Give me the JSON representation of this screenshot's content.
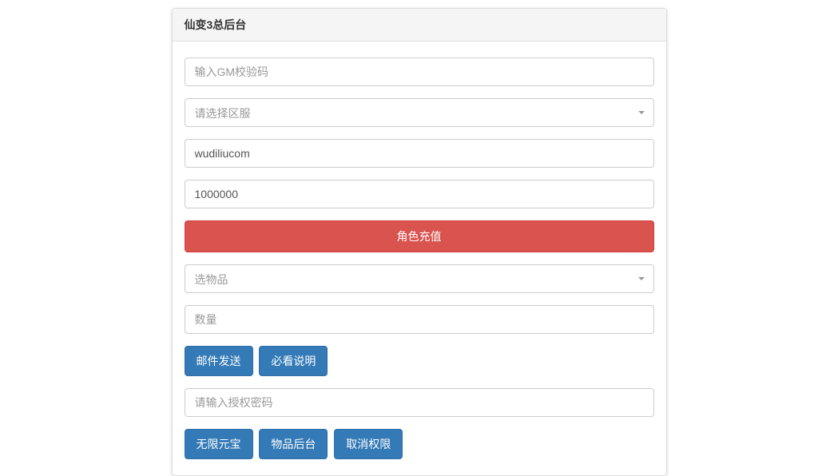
{
  "panel": {
    "title": "仙变3总后台"
  },
  "fields": {
    "gmCode": {
      "placeholder": "输入GM校验码",
      "value": ""
    },
    "serverSelect": {
      "placeholder": "请选择区服"
    },
    "username": {
      "value": "wudiliucom"
    },
    "amount": {
      "value": "1000000"
    },
    "itemSelect": {
      "placeholder": "选物品"
    },
    "quantity": {
      "placeholder": "数量",
      "value": ""
    },
    "authPassword": {
      "placeholder": "请输入授权密码",
      "value": ""
    }
  },
  "buttons": {
    "recharge": "角色充值",
    "sendMail": "邮件发送",
    "mustReadInfo": "必看说明",
    "unlimitedYuanbao": "无限元宝",
    "itemBackend": "物品后台",
    "cancelPermission": "取消权限"
  }
}
